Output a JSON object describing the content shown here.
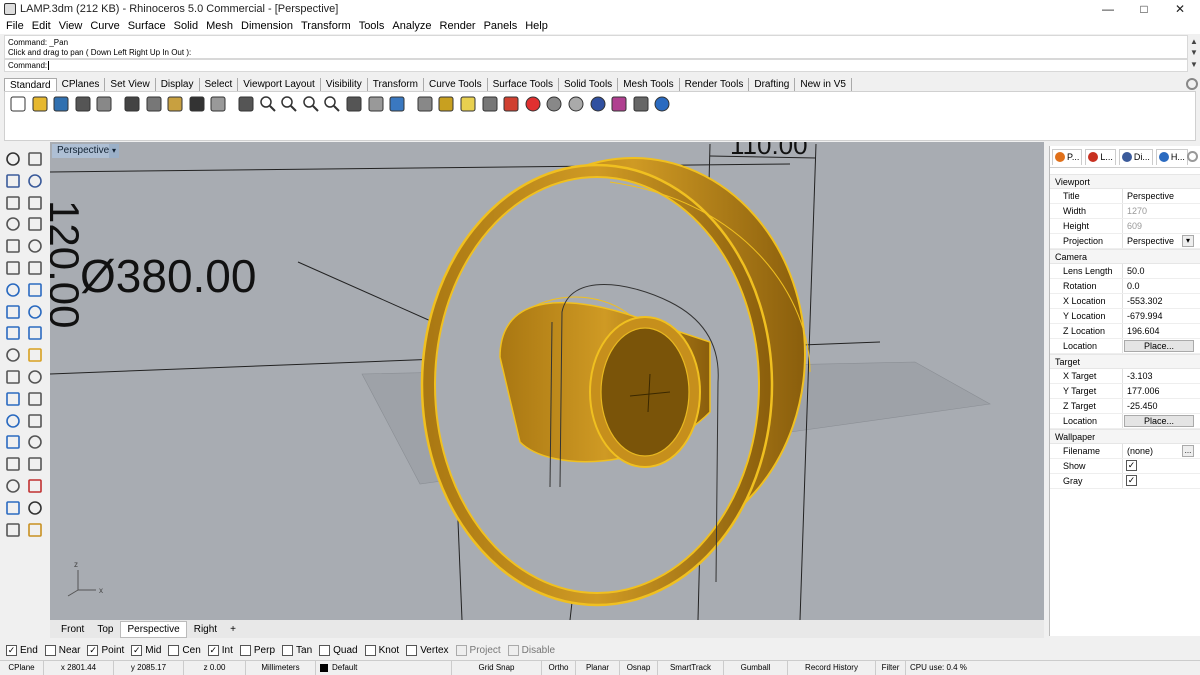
{
  "window": {
    "title": "LAMP.3dm (212 KB) - Rhinoceros 5.0 Commercial - [Perspective]",
    "minimize": "—",
    "maximize": "□",
    "close": "✕"
  },
  "menu": [
    "File",
    "Edit",
    "View",
    "Curve",
    "Surface",
    "Solid",
    "Mesh",
    "Dimension",
    "Transform",
    "Tools",
    "Analyze",
    "Render",
    "Panels",
    "Help"
  ],
  "command": {
    "history": [
      "Command: _Pan",
      "Click and drag to pan ( Down  Left  Right  Up  In  Out ):"
    ],
    "prompt": "Command:"
  },
  "toolbar_tabs": [
    "Standard",
    "CPlanes",
    "Set View",
    "Display",
    "Select",
    "Viewport Layout",
    "Visibility",
    "Transform",
    "Curve Tools",
    "Surface Tools",
    "Solid Tools",
    "Mesh Tools",
    "Render Tools",
    "Drafting",
    "New in V5"
  ],
  "toolbar_icons": [
    "new-icon",
    "open-icon",
    "save-icon",
    "print-icon",
    "import-icon",
    "cut-icon",
    "copy-icon",
    "paste-icon",
    "undo-icon",
    "pan-icon",
    "move-icon",
    "zoom-icon",
    "zoom-window-icon",
    "zoom-extents-icon",
    "zoom-selected-icon",
    "rotate-view-icon",
    "four-viewports-icon",
    "cplane-icon",
    "camera-icon",
    "select-icon",
    "light-icon",
    "lock-icon",
    "layer-icon",
    "color-wheel-icon",
    "shade-icon",
    "render-sphere-icon",
    "rendered-icon",
    "material-icon",
    "settings-icon",
    "help-icon"
  ],
  "viewport": {
    "title": "Perspective",
    "dimension_diameter": "Ø380.00",
    "dimension_vertical": "120.00",
    "dimension_top": "110.00",
    "axis_x": "x",
    "axis_z": "z",
    "tabs": [
      "Front",
      "Top",
      "Perspective",
      "Right"
    ],
    "active_tab": "Perspective",
    "add_tab": "+"
  },
  "osnap": [
    {
      "label": "End",
      "checked": true
    },
    {
      "label": "Near",
      "checked": false
    },
    {
      "label": "Point",
      "checked": true
    },
    {
      "label": "Mid",
      "checked": true
    },
    {
      "label": "Cen",
      "checked": false
    },
    {
      "label": "Int",
      "checked": true
    },
    {
      "label": "Perp",
      "checked": false
    },
    {
      "label": "Tan",
      "checked": false
    },
    {
      "label": "Quad",
      "checked": false
    },
    {
      "label": "Knot",
      "checked": false
    },
    {
      "label": "Vertex",
      "checked": false
    },
    {
      "label": "Project",
      "checked": false,
      "disabled": true
    },
    {
      "label": "Disable",
      "checked": false,
      "disabled": true
    }
  ],
  "status": {
    "cplane": "CPlane",
    "x": "x 2801.44",
    "y": "y 2085.17",
    "z": "z 0.00",
    "units": "Millimeters",
    "layer": "Default",
    "grid_snap": "Grid Snap",
    "ortho": "Ortho",
    "planar": "Planar",
    "osnap": "Osnap",
    "smarttrack": "SmartTrack",
    "gumball": "Gumball",
    "record_history": "Record History",
    "filter": "Filter",
    "cpu": "CPU use: 0.4 %"
  },
  "panel": {
    "tabs": [
      {
        "label": "P...",
        "color": "#e0701a"
      },
      {
        "label": "L...",
        "color": "#c83020"
      },
      {
        "label": "Di...",
        "color": "#3a5a9a"
      },
      {
        "label": "H...",
        "color": "#2a6ac0"
      }
    ],
    "sections": {
      "viewport": "Viewport",
      "camera": "Camera",
      "target": "Target",
      "wallpaper": "Wallpaper"
    },
    "viewport_rows": [
      {
        "label": "Title",
        "value": "Perspective"
      },
      {
        "label": "Width",
        "value": "1270",
        "disabled": true
      },
      {
        "label": "Height",
        "value": "609",
        "disabled": true
      },
      {
        "label": "Projection",
        "value": "Perspective"
      }
    ],
    "camera_rows": [
      {
        "label": "Lens Length",
        "value": "50.0"
      },
      {
        "label": "Rotation",
        "value": "0.0"
      },
      {
        "label": "X Location",
        "value": "-553.302"
      },
      {
        "label": "Y Location",
        "value": "-679.994"
      },
      {
        "label": "Z Location",
        "value": "196.604"
      }
    ],
    "camera_location": {
      "label": "Location",
      "button": "Place..."
    },
    "target_rows": [
      {
        "label": "X Target",
        "value": "-3.103"
      },
      {
        "label": "Y Target",
        "value": "177.006"
      },
      {
        "label": "Z Target",
        "value": "-25.450"
      }
    ],
    "target_location": {
      "label": "Location",
      "button": "Place..."
    },
    "wallpaper": {
      "filename_label": "Filename",
      "filename": "(none)",
      "browse": "...",
      "show_label": "Show",
      "show": true,
      "gray_label": "Gray",
      "gray": true
    }
  },
  "colors": {
    "object": "#b8860b",
    "highlight": "#f0c020",
    "viewport_bg": "#a8acb2"
  }
}
